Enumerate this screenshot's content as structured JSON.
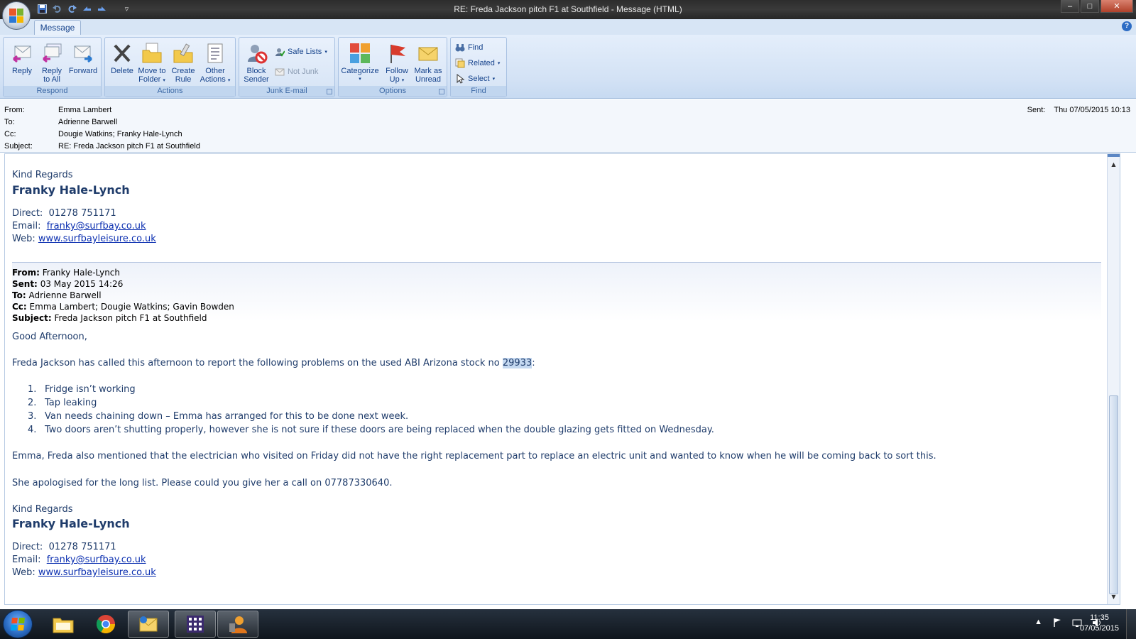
{
  "window": {
    "title": "RE: Freda Jackson pitch F1 at Southfield - Message (HTML)",
    "minimize": "–",
    "maximize": "□",
    "close": "✕"
  },
  "quick_access": {
    "save_icon": "save-icon",
    "undo_icon": "undo-icon",
    "redo_icon": "redo-icon",
    "prev_icon": "previous-item-icon",
    "next_icon": "next-item-icon",
    "customize": "▿"
  },
  "ribbon": {
    "tab": "Message",
    "help": "?",
    "groups": {
      "respond": {
        "label": "Respond",
        "reply": "Reply",
        "reply_all_1": "Reply",
        "reply_all_2": "to All",
        "forward": "Forward"
      },
      "actions": {
        "label": "Actions",
        "delete": "Delete",
        "move_1": "Move to",
        "move_2": "Folder",
        "rule_1": "Create",
        "rule_2": "Rule",
        "other_1": "Other",
        "other_2": "Actions"
      },
      "junk": {
        "label": "Junk E-mail",
        "block_1": "Block",
        "block_2": "Sender",
        "safe_lists": "Safe Lists",
        "not_junk": "Not Junk"
      },
      "options": {
        "label": "Options",
        "categorize": "Categorize",
        "follow_1": "Follow",
        "follow_2": "Up",
        "mark_1": "Mark as",
        "mark_2": "Unread"
      },
      "find": {
        "label": "Find",
        "find": "Find",
        "related": "Related",
        "select": "Select"
      }
    }
  },
  "header": {
    "from_label": "From:",
    "from": "Emma Lambert",
    "to_label": "To:",
    "to": "Adrienne Barwell",
    "cc_label": "Cc:",
    "cc": "Dougie Watkins; Franky Hale-Lynch",
    "subject_label": "Subject:",
    "subject": "RE: Freda Jackson pitch F1 at Southfield",
    "sent_label": "Sent:",
    "sent": "Thu 07/05/2015 10:13"
  },
  "body": {
    "sig1": {
      "regards": "Kind Regards",
      "name": "Franky Hale-Lynch",
      "direct_label": "Direct:",
      "direct": "01278 751171",
      "email_label": "Email:",
      "email": "franky@surfbay.co.uk",
      "web_label": "Web:",
      "web": "www.surfbayleisure.co.uk"
    },
    "quoted": {
      "from_label": "From:",
      "from": "Franky Hale-Lynch",
      "sent_label": "Sent:",
      "sent": "03 May 2015 14:26",
      "to_label": "To:",
      "to": "Adrienne Barwell",
      "cc_label": "Cc:",
      "cc": "Emma Lambert; Dougie Watkins; Gavin Bowden",
      "subject_label": "Subject:",
      "subject": "Freda Jackson pitch F1 at Southfield"
    },
    "greeting": "Good Afternoon,",
    "intro_before": "Freda Jackson has called this afternoon to report the following problems on the used ABI Arizona stock no ",
    "intro_highlight": "29933",
    "intro_after": ":",
    "items": [
      {
        "n": "1.",
        "text": "Fridge isn’t working"
      },
      {
        "n": "2.",
        "text": "Tap leaking"
      },
      {
        "n": "3.",
        "text": "Van needs chaining down – Emma has arranged for this to be done next week."
      },
      {
        "n": "4.",
        "text": "Two doors aren’t shutting properly, however she is not sure if these doors are being replaced when the double glazing gets fitted on Wednesday."
      }
    ],
    "para_electrician": "Emma, Freda also mentioned that the electrician who visited on Friday did not have the right replacement part to replace an electric unit and wanted to know when he will be coming back to sort this.",
    "para_apology": "She apologised for the long list. Please could you give her a call on 07787330640.",
    "sig2": {
      "regards": "Kind Regards",
      "name": "Franky Hale-Lynch",
      "direct_label": "Direct:",
      "direct": "01278 751171",
      "email_label": "Email:",
      "email": "franky@surfbay.co.uk",
      "web_label": "Web:",
      "web": "www.surfbayleisure.co.uk"
    }
  },
  "taskbar": {
    "items": [
      "windows-explorer-icon",
      "chrome-icon",
      "outlook-icon",
      "calculator-app-icon",
      "user-app-icon"
    ],
    "time": "11:35",
    "date": "07/05/2015"
  },
  "colors": {
    "ribbon_text": "#15428b",
    "body_text": "#1f3c6b",
    "link": "#0b2fb0",
    "highlight": "#c5d9f1"
  }
}
